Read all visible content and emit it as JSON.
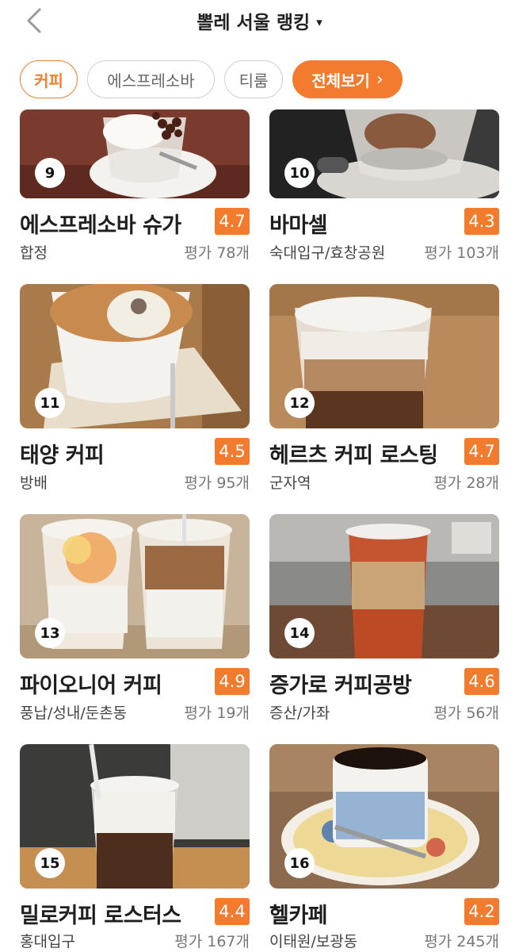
{
  "header": {
    "title": "뽈레 서울 랭킹",
    "caret": "▾"
  },
  "filters": [
    {
      "label": "커피"
    },
    {
      "label": "에스프레소바"
    },
    {
      "label": "티룸"
    },
    {
      "label": "전체보기",
      "arrow": "›"
    }
  ],
  "cafes": [
    {
      "rank": "9",
      "name": "에스프레소바 슈가",
      "score": "4.7",
      "area": "합정",
      "reviews": "평가 78개"
    },
    {
      "rank": "10",
      "name": "바마셀",
      "score": "4.3",
      "area": "숙대입구/효창공원",
      "reviews": "평가 103개"
    },
    {
      "rank": "11",
      "name": "태양 커피",
      "score": "4.5",
      "area": "방배",
      "reviews": "평가 95개"
    },
    {
      "rank": "12",
      "name": "헤르츠 커피 로스팅",
      "score": "4.7",
      "area": "군자역",
      "reviews": "평가 28개"
    },
    {
      "rank": "13",
      "name": "파이오니어 커피",
      "score": "4.9",
      "area": "풍납/성내/둔촌동",
      "reviews": "평가 19개"
    },
    {
      "rank": "14",
      "name": "증가로 커피공방",
      "score": "4.6",
      "area": "증산/가좌",
      "reviews": "평가 56개"
    },
    {
      "rank": "15",
      "name": "밀로커피 로스터스",
      "score": "4.4",
      "area": "홍대입구",
      "reviews": "평가 167개"
    },
    {
      "rank": "16",
      "name": "헬카페",
      "score": "4.2",
      "area": "이태원/보광동",
      "reviews": "평가 245개"
    }
  ],
  "colors": {
    "accent": "#f27b2d",
    "chip_border": "#cfcfcf"
  },
  "icons": {
    "back": "chevron-left-icon",
    "dropdown": "caret-down-icon",
    "all_arrow": "chevron-right-icon"
  }
}
